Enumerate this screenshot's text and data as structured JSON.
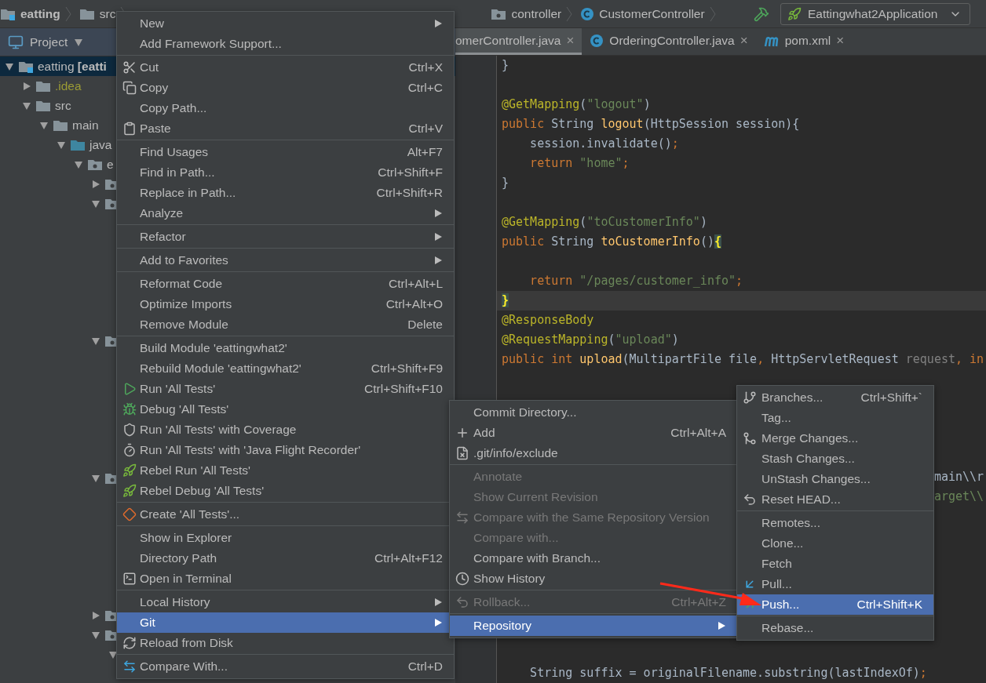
{
  "breadcrumb": [
    {
      "label": "eatting",
      "kind": "module"
    },
    {
      "label": "src",
      "kind": "folder"
    },
    {
      "label": "controller",
      "kind": "package"
    },
    {
      "label": "CustomerController",
      "kind": "class"
    }
  ],
  "run_config": {
    "label": "Eattingwhat2Application"
  },
  "project_panel": {
    "title": "Project",
    "tree": [
      {
        "label": "eatting **[eatti**",
        "kind": "module",
        "expanded": true,
        "selected": true,
        "color": "#bbbbbb",
        "children": [
          {
            "label": ".idea",
            "kind": "folder",
            "expanded": false,
            "selected": false,
            "color": "#9b9b35"
          },
          {
            "label": "src",
            "kind": "folder",
            "expanded": true,
            "selected": false,
            "color": "#bbbbbb",
            "children": [
              {
                "label": "main",
                "kind": "folder",
                "expanded": true,
                "selected": false,
                "color": "#bbbbbb",
                "children": [
                  {
                    "label": "java",
                    "kind": "source_root",
                    "expanded": true,
                    "selected": false,
                    "color": "#bbbbbb",
                    "children": [
                      {
                        "label": "e",
                        "kind": "package",
                        "expanded": true,
                        "selected": false,
                        "color": "#bbbbbb",
                        "children": [
                          {
                            "kind": "package",
                            "expanded": false,
                            "selected": false
                          },
                          {
                            "kind": "package",
                            "expanded": true,
                            "selected": false,
                            "children": [
                              {
                                "kind": "file"
                              },
                              {
                                "kind": "file"
                              },
                              {
                                "kind": "file"
                              },
                              {
                                "kind": "file"
                              },
                              {
                                "kind": "file"
                              },
                              {
                                "kind": "file"
                              }
                            ]
                          },
                          {
                            "kind": "package",
                            "expanded": true,
                            "selected": false,
                            "children": [
                              {
                                "kind": "file"
                              },
                              {
                                "kind": "file"
                              },
                              {
                                "kind": "file"
                              },
                              {
                                "kind": "file"
                              },
                              {
                                "kind": "file"
                              },
                              {
                                "kind": "file"
                              }
                            ]
                          },
                          {
                            "kind": "package",
                            "expanded": true,
                            "selected": false,
                            "children": [
                              {
                                "kind": "file"
                              },
                              {
                                "kind": "file"
                              },
                              {
                                "kind": "file"
                              },
                              {
                                "kind": "file"
                              },
                              {
                                "kind": "file"
                              },
                              {
                                "kind": "file"
                              }
                            ]
                          },
                          {
                            "kind": "package",
                            "expanded": false,
                            "selected": false
                          },
                          {
                            "kind": "package",
                            "expanded": true,
                            "selected": false,
                            "children": [
                              {
                                "expanded": true,
                                "selected": false
                              }
                            ]
                          }
                        ]
                      }
                    ]
                  }
                ]
              }
            ]
          }
        ]
      }
    ]
  },
  "editor_tabs": [
    {
      "label": "omerController.java",
      "close": "×",
      "selected": true
    },
    {
      "label": "OrderingController.java",
      "kind": "class",
      "close": "×",
      "selected": false
    },
    {
      "label": "pom.xml",
      "kind": "maven",
      "close": "×",
      "selected": false
    }
  ],
  "code_lines": [
    {
      "current": false,
      "segments": [
        {
          "text": "}",
          "kind": "plain"
        }
      ]
    },
    {
      "current": false
    },
    {
      "current": false,
      "segments": [
        {
          "text": "@GetMapping",
          "kind": "annotation"
        },
        {
          "text": "(",
          "kind": "plain"
        },
        {
          "text": "\"logout\"",
          "kind": "string"
        },
        {
          "text": ")",
          "kind": "plain"
        }
      ]
    },
    {
      "current": false,
      "segments": [
        {
          "text": "public ",
          "kind": "keyword"
        },
        {
          "text": "String ",
          "kind": "plain"
        },
        {
          "text": "logout",
          "kind": "method"
        },
        {
          "text": "(HttpSession session){",
          "kind": "plain"
        }
      ]
    },
    {
      "current": false,
      "segments": [
        {
          "text": "    session.invalidate()",
          "kind": "plain"
        },
        {
          "text": ";",
          "kind": "keyword"
        }
      ]
    },
    {
      "current": false,
      "segments": [
        {
          "text": "    return ",
          "kind": "keyword"
        },
        {
          "text": "\"home\"",
          "kind": "string"
        },
        {
          "text": ";",
          "kind": "keyword"
        }
      ]
    },
    {
      "current": false,
      "segments": [
        {
          "text": "}",
          "kind": "plain"
        }
      ]
    },
    {
      "current": false
    },
    {
      "current": false,
      "segments": [
        {
          "text": "@GetMapping",
          "kind": "annotation"
        },
        {
          "text": "(",
          "kind": "plain"
        },
        {
          "text": "\"toCustomerInfo\"",
          "kind": "string"
        },
        {
          "text": ")",
          "kind": "plain"
        }
      ]
    },
    {
      "current": false,
      "segments": [
        {
          "text": "public ",
          "kind": "keyword"
        },
        {
          "text": "String ",
          "kind": "plain"
        },
        {
          "text": "toCustomerInfo",
          "kind": "method"
        },
        {
          "text": "()",
          "kind": "plain"
        },
        {
          "text": "{",
          "kind": "brace_match"
        }
      ]
    },
    {
      "current": false
    },
    {
      "current": false,
      "segments": [
        {
          "text": "    return ",
          "kind": "keyword"
        },
        {
          "text": "\"/pages/customer_info\"",
          "kind": "string"
        },
        {
          "text": ";",
          "kind": "keyword"
        }
      ]
    },
    {
      "current": true,
      "segments": [
        {
          "text": "}",
          "kind": "brace_match"
        }
      ]
    },
    {
      "current": false,
      "segments": [
        {
          "text": "@ResponseBody",
          "kind": "annotation"
        }
      ]
    },
    {
      "current": false,
      "segments": [
        {
          "text": "@RequestMapping",
          "kind": "annotation"
        },
        {
          "text": "(",
          "kind": "plain"
        },
        {
          "text": "\"upload\"",
          "kind": "string"
        },
        {
          "text": ")",
          "kind": "plain"
        }
      ]
    },
    {
      "current": false,
      "segments": [
        {
          "text": "public int ",
          "kind": "keyword"
        },
        {
          "text": "upload",
          "kind": "method"
        },
        {
          "text": "(MultipartFile file",
          "kind": "plain"
        },
        {
          "text": ", ",
          "kind": "keyword"
        },
        {
          "text": "HttpServletRequest ",
          "kind": "plain"
        },
        {
          "text": "request",
          "kind": "unused"
        },
        {
          "text": ", in",
          "kind": "keyword"
        }
      ]
    },
    {
      "current": false
    },
    {
      "current": false
    },
    {
      "current": false
    },
    {
      "current": false
    },
    {
      "current": false
    },
    {
      "current": false,
      "segments": [
        {
          "text": "                                                             main\\\\r",
          "kind": "plain"
        }
      ]
    },
    {
      "current": false,
      "segments": [
        {
          "text": "                                                             arget\\\\",
          "kind": "string"
        }
      ]
    },
    {
      "current": false
    },
    {
      "current": false
    },
    {
      "current": false
    },
    {
      "current": false
    },
    {
      "current": false
    },
    {
      "current": false
    },
    {
      "current": false
    },
    {
      "current": false
    },
    {
      "current": false,
      "segments": [
        {
          "text": "    String suffix = originalFilename.substring(lastIndexOf)",
          "kind": "plain"
        },
        {
          "text": ";",
          "kind": "keyword"
        }
      ]
    }
  ],
  "context_menu": {
    "groups": [
      [
        {
          "label": "New",
          "submenu": true,
          "selected": false
        },
        {
          "label": "Add Framework Support...",
          "selected": false
        }
      ],
      [
        {
          "label": "Cut",
          "shortcut": "Ctrl+X",
          "selected": false
        },
        {
          "label": "Copy",
          "shortcut": "Ctrl+C",
          "selected": false
        },
        {
          "label": "Copy Path...",
          "selected": false
        },
        {
          "label": "Paste",
          "shortcut": "Ctrl+V",
          "selected": false
        }
      ],
      [
        {
          "label": "Find Usages",
          "shortcut": "Alt+F7",
          "selected": false
        },
        {
          "label": "Find in Path...",
          "shortcut": "Ctrl+Shift+F",
          "selected": false
        },
        {
          "label": "Replace in Path...",
          "shortcut": "Ctrl+Shift+R",
          "selected": false
        },
        {
          "label": "Analyze",
          "submenu": true,
          "selected": false
        }
      ],
      [
        {
          "label": "Refactor",
          "submenu": true,
          "selected": false
        }
      ],
      [
        {
          "label": "Add to Favorites",
          "submenu": true,
          "selected": false
        }
      ],
      [
        {
          "label": "Reformat Code",
          "shortcut": "Ctrl+Alt+L",
          "selected": false
        },
        {
          "label": "Optimize Imports",
          "shortcut": "Ctrl+Alt+O",
          "selected": false
        },
        {
          "label": "Remove Module",
          "shortcut": "Delete",
          "selected": false
        }
      ],
      [
        {
          "label": "Build Module 'eattingwhat2'",
          "selected": false
        },
        {
          "label": "Rebuild Module 'eattingwhat2'",
          "shortcut": "Ctrl+Shift+F9",
          "selected": false
        },
        {
          "label": "Run 'All Tests'",
          "shortcut": "Ctrl+Shift+F10",
          "selected": false
        },
        {
          "label": "Debug 'All Tests'",
          "selected": false
        },
        {
          "label": "Run 'All Tests' with Coverage",
          "selected": false
        },
        {
          "label": "Run 'All Tests' with 'Java Flight Recorder'",
          "selected": false
        },
        {
          "label": "Rebel Run 'All Tests'",
          "selected": false
        },
        {
          "label": "Rebel Debug 'All Tests'",
          "selected": false
        }
      ],
      [
        {
          "label": "Create 'All Tests'...",
          "selected": false
        }
      ],
      [
        {
          "label": "Show in Explorer",
          "selected": false
        },
        {
          "label": "Directory Path",
          "shortcut": "Ctrl+Alt+F12",
          "selected": false
        },
        {
          "label": "Open in Terminal",
          "selected": false
        }
      ],
      [
        {
          "label": "Local History",
          "submenu": true,
          "selected": false
        },
        {
          "label": "Git",
          "submenu": true,
          "selected": true
        },
        {
          "label": "Reload from Disk",
          "selected": false
        }
      ],
      [
        {
          "label": "Compare With...",
          "shortcut": "Ctrl+D",
          "selected": false
        }
      ]
    ]
  },
  "git_menu": {
    "groups": [
      [
        {
          "label": "Commit Directory...",
          "selected": false,
          "disabled": false
        },
        {
          "label": "Add",
          "shortcut": "Ctrl+Alt+A",
          "selected": false,
          "disabled": false
        },
        {
          "label": ".git/info/exclude",
          "selected": false,
          "disabled": false
        }
      ],
      [
        {
          "label": "Annotate",
          "selected": false,
          "disabled": true
        },
        {
          "label": "Show Current Revision",
          "selected": false,
          "disabled": true
        },
        {
          "label": "Compare with the Same Repository Version",
          "selected": false,
          "disabled": true
        },
        {
          "label": "Compare with...",
          "selected": false,
          "disabled": true
        },
        {
          "label": "Compare with Branch...",
          "selected": false,
          "disabled": false
        },
        {
          "label": "Show History",
          "selected": false,
          "disabled": false
        }
      ],
      [
        {
          "label": "Rollback...",
          "shortcut": "Ctrl+Alt+Z",
          "selected": false,
          "disabled": true
        }
      ],
      [
        {
          "label": "Repository",
          "submenu": true,
          "selected": true,
          "disabled": false
        }
      ]
    ]
  },
  "repository_menu": {
    "groups": [
      [
        {
          "label": "Branches...",
          "shortcut": "Ctrl+Shift+`",
          "selected": false
        },
        {
          "label": "Tag...",
          "selected": false
        },
        {
          "label": "Merge Changes...",
          "selected": false
        },
        {
          "label": "Stash Changes...",
          "selected": false
        },
        {
          "label": "UnStash Changes...",
          "selected": false
        },
        {
          "label": "Reset HEAD...",
          "selected": false
        }
      ],
      [
        {
          "label": "Remotes...",
          "selected": false
        },
        {
          "label": "Clone...",
          "selected": false
        },
        {
          "label": "Fetch",
          "selected": false
        },
        {
          "label": "Pull...",
          "selected": false
        },
        {
          "label": "Push...",
          "shortcut": "Ctrl+Shift+K",
          "selected": true
        }
      ],
      [
        {
          "label": "Rebase...",
          "selected": false
        }
      ]
    ]
  }
}
